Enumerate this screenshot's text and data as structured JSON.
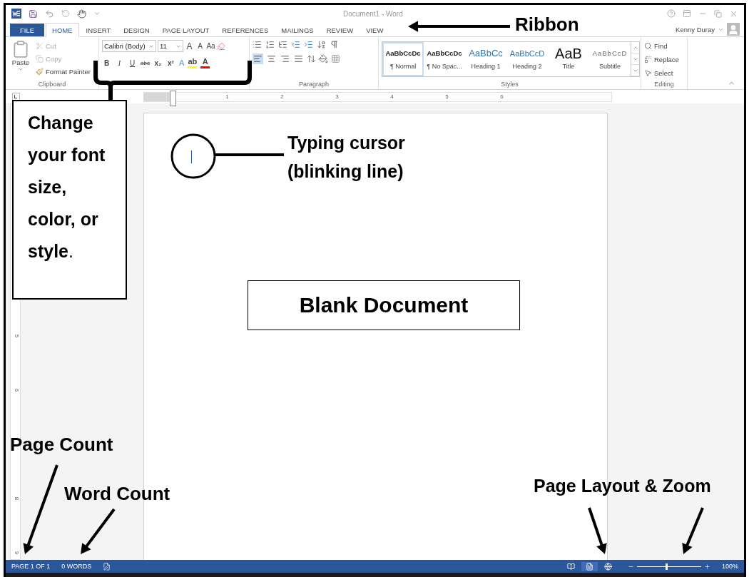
{
  "title_bar": {
    "title": "Document1 - Word"
  },
  "tabs": [
    {
      "label": "FILE",
      "kind": "file",
      "selected": false
    },
    {
      "label": "HOME",
      "kind": "tab",
      "selected": true
    },
    {
      "label": "INSERT",
      "kind": "tab",
      "selected": false
    },
    {
      "label": "DESIGN",
      "kind": "tab",
      "selected": false
    },
    {
      "label": "PAGE LAYOUT",
      "kind": "tab",
      "selected": false
    },
    {
      "label": "REFERENCES",
      "kind": "tab",
      "selected": false
    },
    {
      "label": "MAILINGS",
      "kind": "tab",
      "selected": false
    },
    {
      "label": "REVIEW",
      "kind": "tab",
      "selected": false
    },
    {
      "label": "VIEW",
      "kind": "tab",
      "selected": false
    }
  ],
  "account": {
    "name": "Kenny Duray"
  },
  "clipboard": {
    "paste": "Paste",
    "label": "Clipboard",
    "items": [
      {
        "label": "Cut",
        "kind": "cut",
        "disabled": true
      },
      {
        "label": "Copy",
        "kind": "copy",
        "disabled": true
      },
      {
        "label": "Format Painter",
        "kind": "painter",
        "disabled": false
      }
    ]
  },
  "font": {
    "name": "Calibri (Body)",
    "size": "11",
    "case_button": "Aa",
    "size_buttons": [
      {
        "label": "A",
        "kind": "grow"
      },
      {
        "label": "A",
        "kind": "shrink"
      }
    ],
    "format_buttons": [
      {
        "label": "B",
        "kind": "bold"
      },
      {
        "label": "I",
        "kind": "italic"
      },
      {
        "label": "U",
        "kind": "underline"
      },
      {
        "label": "abc",
        "kind": "strike"
      },
      {
        "label": "x₂",
        "kind": "sub"
      },
      {
        "label": "x²",
        "kind": "super"
      }
    ],
    "color_buttons": [
      {
        "label": "A",
        "kind": "effects",
        "color": "#5b9bd5"
      },
      {
        "label": "ab",
        "kind": "highlight",
        "color": "#ffff00"
      },
      {
        "label": "A",
        "kind": "color",
        "color": "#ff0000"
      }
    ]
  },
  "paragraph": {
    "label": "Paragraph",
    "alignment": [
      {
        "kind": "left",
        "selected": true
      },
      {
        "kind": "center",
        "selected": false
      },
      {
        "kind": "right",
        "selected": false
      },
      {
        "kind": "justify",
        "selected": false
      }
    ]
  },
  "styles": {
    "label": "Styles",
    "items": [
      {
        "preview": "AaBbCcDc",
        "name": "¶ Normal",
        "kind": "normal",
        "selected": true
      },
      {
        "preview": "AaBbCcDc",
        "name": "¶ No Spac...",
        "kind": "nospacing",
        "selected": false
      },
      {
        "preview": "AaBbCc",
        "name": "Heading 1",
        "kind": "heading1",
        "selected": false
      },
      {
        "preview": "AaBbCcD",
        "name": "Heading 2",
        "kind": "heading2",
        "selected": false
      },
      {
        "preview": "AaB",
        "name": "Title",
        "kind": "title",
        "selected": false
      },
      {
        "preview": "AaBbCcD",
        "name": "Subtitle",
        "kind": "subtitle",
        "selected": false
      }
    ]
  },
  "editing": {
    "label": "Editing",
    "items": [
      {
        "label": "Find",
        "kind": "find"
      },
      {
        "label": "Replace",
        "kind": "replace"
      },
      {
        "label": "Select",
        "kind": "select"
      }
    ]
  },
  "ruler": {
    "numbers": [
      "1",
      "2",
      "3",
      "4",
      "5",
      "6"
    ]
  },
  "vertical_ruler": {
    "numbers": [
      "5",
      "6",
      "8",
      "9"
    ]
  },
  "status_bar": {
    "page": "PAGE 1 OF 1",
    "words": "0 WORDS",
    "views": [
      {
        "kind": "read",
        "selected": false
      },
      {
        "kind": "print",
        "selected": true
      },
      {
        "kind": "web",
        "selected": false
      }
    ],
    "zoom": {
      "level": 0.45,
      "reading": "100%"
    }
  },
  "annotations": {
    "ribbon": "Ribbon",
    "callout": "**Change your font size, color, or style**.",
    "cursor": "Typing cursor (blinking line)",
    "document": "Blank Document",
    "page_count": "Page Count",
    "word_count": "Word Count",
    "layout_zoom": "Page Layout & Zoom"
  }
}
